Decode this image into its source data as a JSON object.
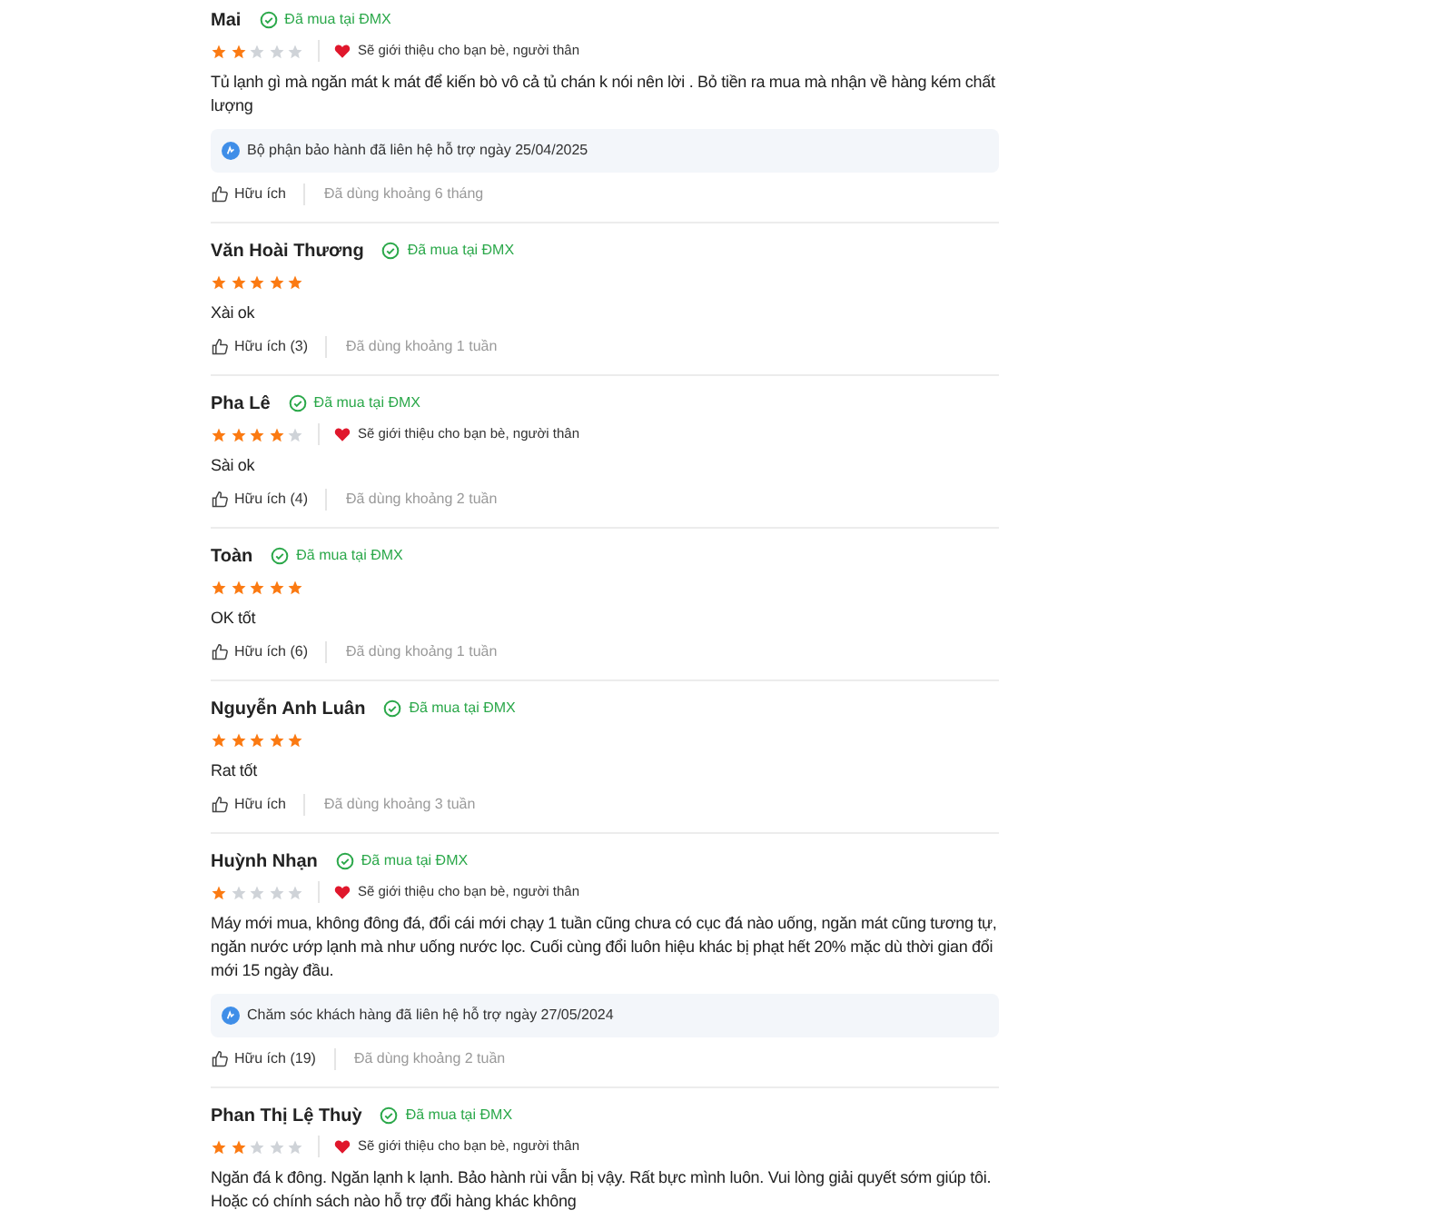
{
  "reviews": [
    {
      "name": "Mai",
      "verified": "Đã mua tại ĐMX",
      "stars": 2,
      "recommend": "Sẽ giới thiệu cho bạn bè, người thân",
      "content": "Tủ lạnh gì mà ngăn mát k mát để kiến bò vô cả tủ chán k nói nên lời . Bỏ tiền ra mua mà nhận về hàng kém chất lượng",
      "support": "Bộ phận bảo hành đã liên hệ hỗ trợ ngày 25/04/2025",
      "helpful": "Hữu ích",
      "usage": "Đã dùng khoảng 6 tháng"
    },
    {
      "name": "Văn Hoài Thương",
      "verified": "Đã mua tại ĐMX",
      "stars": 5,
      "content": "Xài ok",
      "helpful": "Hữu ích (3)",
      "usage": "Đã dùng khoảng 1 tuần"
    },
    {
      "name": "Pha Lê",
      "verified": "Đã mua tại ĐMX",
      "stars": 4,
      "recommend": "Sẽ giới thiệu cho bạn bè, người thân",
      "content": "Sài ok",
      "helpful": "Hữu ích (4)",
      "usage": "Đã dùng khoảng 2 tuần"
    },
    {
      "name": "Toàn",
      "verified": "Đã mua tại ĐMX",
      "stars": 5,
      "content": "OK tốt",
      "helpful": "Hữu ích (6)",
      "usage": "Đã dùng khoảng 1 tuần"
    },
    {
      "name": "Nguyễn Anh Luân",
      "verified": "Đã mua tại ĐMX",
      "stars": 5,
      "content": "Rat tốt",
      "helpful": "Hữu ích",
      "usage": "Đã dùng khoảng 3 tuần"
    },
    {
      "name": "Huỳnh Nhạn",
      "verified": "Đã mua tại ĐMX",
      "stars": 1,
      "recommend": "Sẽ giới thiệu cho bạn bè, người thân",
      "content": "Máy mới mua, không đông đá, đổi cái mới chạy 1 tuần cũng chưa có cục đá nào uống, ngăn mát cũng tương tự, ngăn nước ướp lạnh mà như uống nước lọc. Cuối cùng đổi luôn hiệu khác bị phạt hết 20% mặc dù thời gian đổi mới 15 ngày đầu.",
      "support": "Chăm sóc khách hàng đã liên hệ hỗ trợ ngày 27/05/2024",
      "helpful": "Hữu ích (19)",
      "usage": "Đã dùng khoảng 2 tuần"
    },
    {
      "name": "Phan Thị Lệ Thuỳ",
      "verified": "Đã mua tại ĐMX",
      "stars": 2,
      "recommend": "Sẽ giới thiệu cho bạn bè, người thân",
      "content": "Ngăn đá k đông. Ngăn lạnh k lạnh. Bảo hành rùi vẫn bị vậy. Rất bực mình luôn. Vui lòng giải quyết sớm giúp tôi. Hoặc có chính sách nào hỗ trợ đổi hàng khác không"
    }
  ]
}
